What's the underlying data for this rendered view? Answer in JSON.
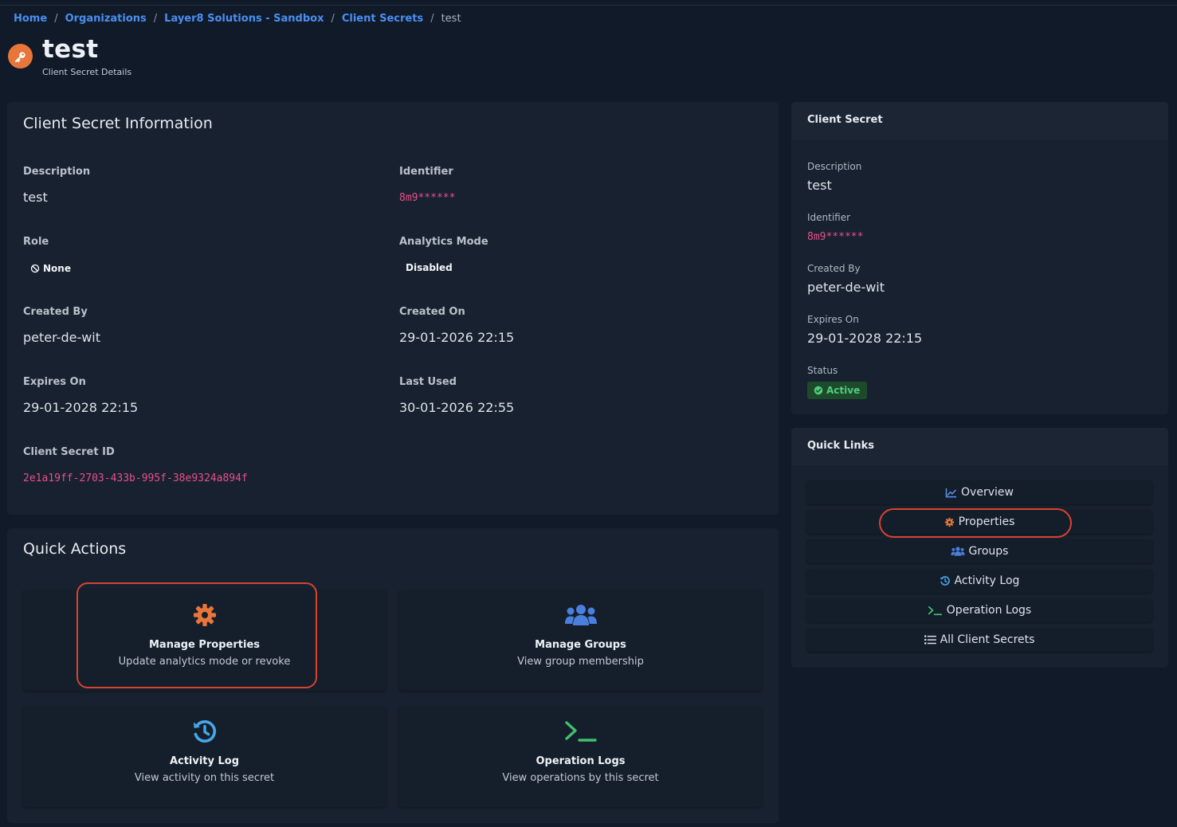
{
  "breadcrumb": {
    "items": [
      "Home",
      "Organizations",
      "Layer8 Solutions - Sandbox",
      "Client Secrets"
    ],
    "current": "test"
  },
  "page": {
    "title": "test",
    "subtitle": "Client Secret Details"
  },
  "info": {
    "title": "Client Secret Information",
    "description_label": "Description",
    "description": "test",
    "identifier_label": "Identifier",
    "identifier": "8m9******",
    "role_label": "Role",
    "role": "None",
    "analytics_label": "Analytics Mode",
    "analytics": "Disabled",
    "created_by_label": "Created By",
    "created_by": "peter-de-wit",
    "created_on_label": "Created On",
    "created_on": "29-01-2026 22:15",
    "expires_label": "Expires On",
    "expires": "29-01-2028 22:15",
    "last_used_label": "Last Used",
    "last_used": "30-01-2026 22:55",
    "id_label": "Client Secret ID",
    "id": "2e1a19ff-2703-433b-995f-38e9324a894f"
  },
  "quick_actions": {
    "title": "Quick Actions",
    "tiles": [
      {
        "title": "Manage Properties",
        "desc": "Update analytics mode or revoke",
        "icon": "gear-icon"
      },
      {
        "title": "Manage Groups",
        "desc": "View group membership",
        "icon": "users-icon"
      },
      {
        "title": "Activity Log",
        "desc": "View activity on this secret",
        "icon": "history-icon"
      },
      {
        "title": "Operation Logs",
        "desc": "View operations by this secret",
        "icon": "terminal-icon"
      }
    ]
  },
  "sidebar": {
    "title": "Client Secret",
    "description_label": "Description",
    "description": "test",
    "identifier_label": "Identifier",
    "identifier": "8m9******",
    "created_by_label": "Created By",
    "created_by": "peter-de-wit",
    "expires_label": "Expires On",
    "expires": "29-01-2028 22:15",
    "status_label": "Status",
    "status": "Active"
  },
  "quick_links": {
    "title": "Quick Links",
    "items": [
      "Overview",
      "Properties",
      "Groups",
      "Activity Log",
      "Operation Logs",
      "All Client Secrets"
    ]
  },
  "colors": {
    "accent": "#4a8ff0",
    "orange": "#e8763a",
    "pink": "#ea4f8c",
    "green": "#4fce7a",
    "highlight": "#d6442e"
  }
}
